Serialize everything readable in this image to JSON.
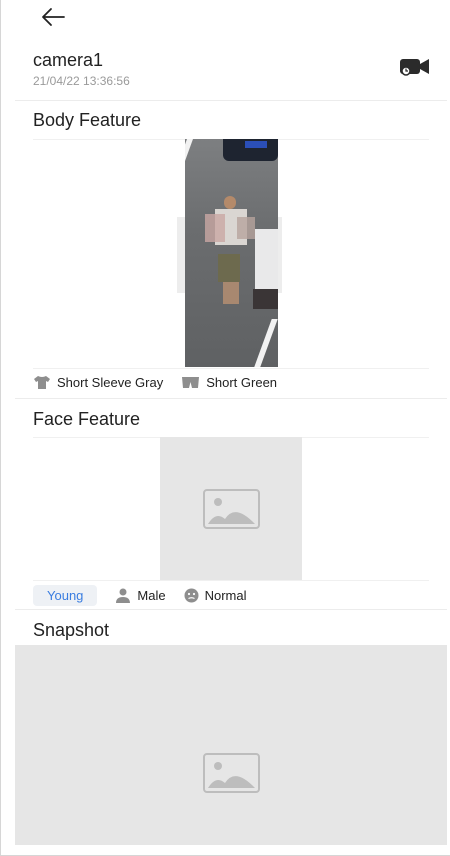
{
  "header": {
    "camera_name": "camera1",
    "timestamp": "21/04/22 13:36:56"
  },
  "body_feature": {
    "title": "Body Feature",
    "attributes": [
      {
        "icon": "t-shirt-icon",
        "label": "Short Sleeve Gray"
      },
      {
        "icon": "shorts-icon",
        "label": "Short Green"
      }
    ]
  },
  "face_feature": {
    "title": "Face Feature",
    "age": "Young",
    "attributes": [
      {
        "icon": "person-icon",
        "label": "Male"
      },
      {
        "icon": "face-icon",
        "label": "Normal"
      }
    ]
  },
  "snapshot": {
    "title": "Snapshot"
  },
  "colors": {
    "accent": "#3a7de0",
    "placeholder_bg": "#e6e6e6",
    "divider": "#ececec"
  }
}
